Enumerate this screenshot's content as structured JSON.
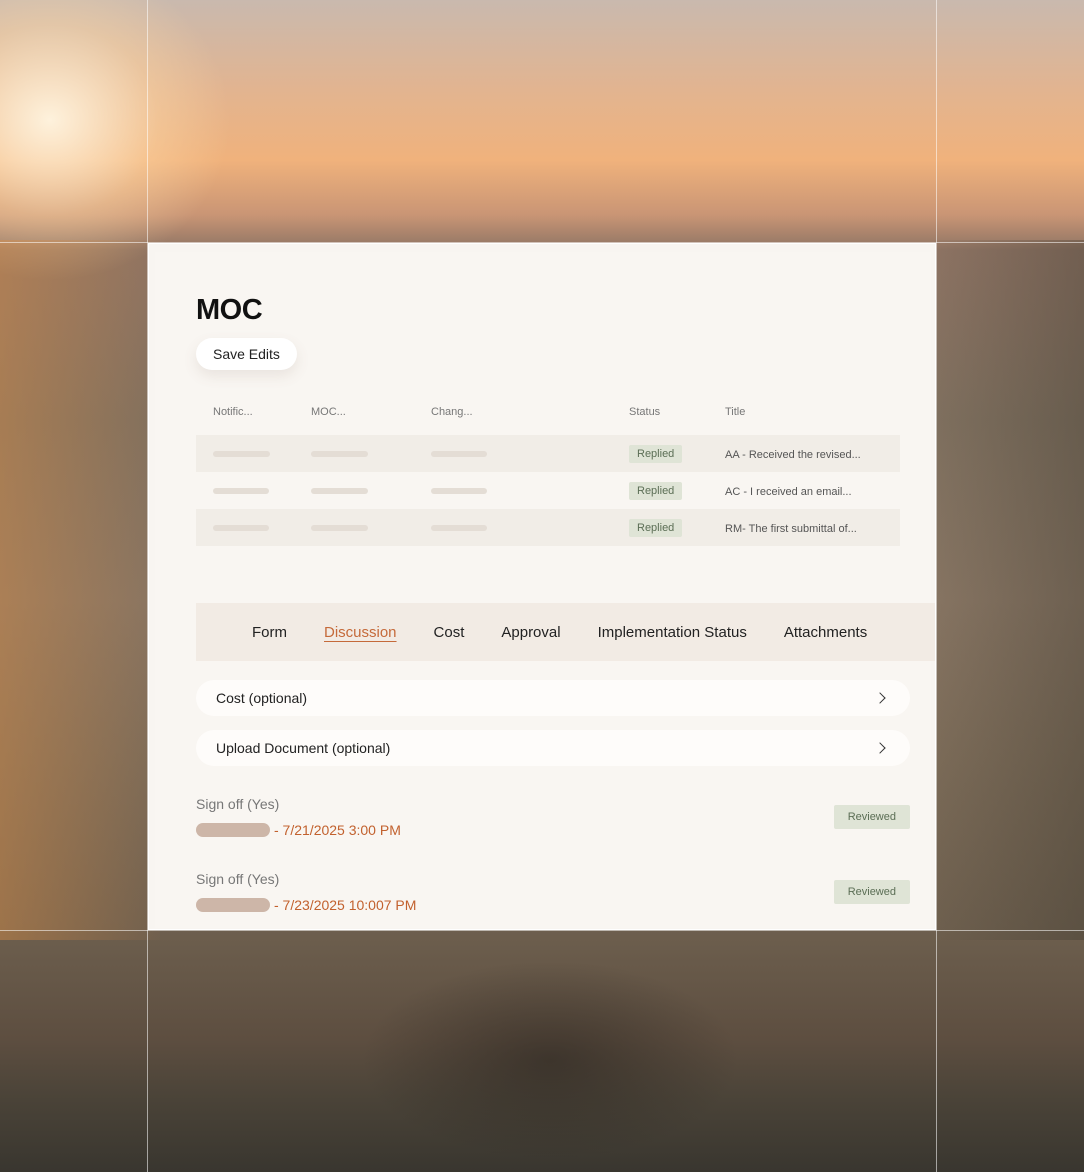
{
  "page": {
    "title": "MOC"
  },
  "toolbar": {
    "save_label": "Save Edits"
  },
  "table": {
    "columns": [
      "Notific...",
      "MOC...",
      "Chang...",
      "Status",
      "Title"
    ],
    "rows": [
      {
        "status": "Replied",
        "title": "AA - Received the revised..."
      },
      {
        "status": "Replied",
        "title": "AC - I received an email..."
      },
      {
        "status": "Replied",
        "title": "RM- The first submittal of..."
      }
    ]
  },
  "tabs": [
    {
      "label": "Form",
      "active": false
    },
    {
      "label": "Discussion",
      "active": true
    },
    {
      "label": "Cost",
      "active": false
    },
    {
      "label": "Approval",
      "active": false
    },
    {
      "label": "Implementation Status",
      "active": false
    },
    {
      "label": "Attachments",
      "active": false
    }
  ],
  "sections": [
    {
      "label": "Cost (optional)",
      "icon": "chevron-right-icon"
    },
    {
      "label": "Upload Document (optional)",
      "icon": "chevron-right-icon"
    }
  ],
  "signoffs": [
    {
      "label": "Sign off (Yes)",
      "timestamp": "- 7/21/2025 3:00 PM",
      "badge": "Reviewed"
    },
    {
      "label": "Sign off (Yes)",
      "timestamp": "- 7/23/2025 10:007 PM",
      "badge": "Reviewed"
    }
  ],
  "colors": {
    "accent": "#c56a3a",
    "status_green_bg": "#dfe4d6",
    "status_green_text": "#5b6e55",
    "panel_bg": "#f9f6f2"
  }
}
